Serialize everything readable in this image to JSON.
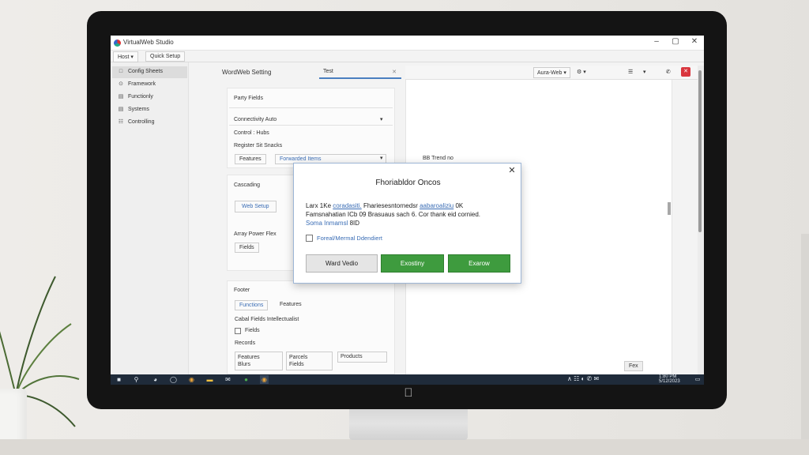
{
  "window": {
    "title": "VirtualWeb Studio",
    "minimize": "–",
    "maximize": "▢",
    "close": "✕"
  },
  "menubar": {
    "menu1": "Host ▾",
    "menu2": "Quick Setup"
  },
  "sidebar": {
    "items": [
      {
        "label": "Config Sheets",
        "icon": "□"
      },
      {
        "label": "Framework",
        "icon": "⊙"
      },
      {
        "label": "Functionly",
        "icon": "▤"
      },
      {
        "label": "Systems",
        "icon": "▤"
      },
      {
        "label": "Controlling",
        "icon": "☷"
      }
    ]
  },
  "panel": {
    "header": "WordWeb Setting",
    "tab_input": "Test",
    "card1": {
      "title": "Party Fields",
      "row1": "Connectivity Auto",
      "row2": "Control : Hubs",
      "row3": "Register Sit Snacks",
      "btn_left": "Features",
      "select": "Forwarded Items"
    },
    "card2": {
      "title": "Cascading",
      "btn": "Web Setup",
      "sub": "Array Power Flex",
      "btn2": "Fields"
    },
    "card3": {
      "title": "Footer",
      "tab1": "Functions",
      "tab2": "Features",
      "chk_header": "Cabal Fields Intellectualist",
      "chk_label": "Fields",
      "sub": "Records",
      "cell1a": "Features",
      "cell1b": "Blurs",
      "cell2a": "Parcels",
      "cell2b": "Fields",
      "cell3a": "Products"
    }
  },
  "toolbar": {
    "dropdown": "Aura‑Web ▾",
    "gear": "⚙ ▾",
    "list": "☰",
    "menu": "▾",
    "phone": "✆",
    "red_close": "✕"
  },
  "canvas": {
    "label": "BB Trend no"
  },
  "dialog": {
    "title": "Fhoriabldor Oncos",
    "close": "✕",
    "line1_pre": "Larx 1Ke ",
    "line1_link1": "coradasiti.",
    "line1_mid": " Fhariesesntornedsr ",
    "line1_link2": "aabaroaliziu",
    "line1_end": " 0K",
    "line2": "Famsnahatian ICb 09 Brasuaus sach 6. Cor thank eid cornied.",
    "line3_link": "Soma Inmamsl",
    "line3_end": " 8ID",
    "checkbox": "Foreal/Mermal Ddendiert",
    "btn_gray": "Ward Vedio",
    "btn_green1": "Exostiny",
    "btn_green2": "Exarow"
  },
  "bottom_right": {
    "button": "Fex"
  },
  "taskbar": {
    "tray": "∧ ☷ ◐ ✆ ✉",
    "clock": "1:80 PM\n5/12/2023"
  },
  "colors": {
    "accent_green": "#3e9b3e",
    "accent_blue": "#3a6db5",
    "close_red": "#d9363e",
    "taskbar": "#1f2b3a"
  }
}
